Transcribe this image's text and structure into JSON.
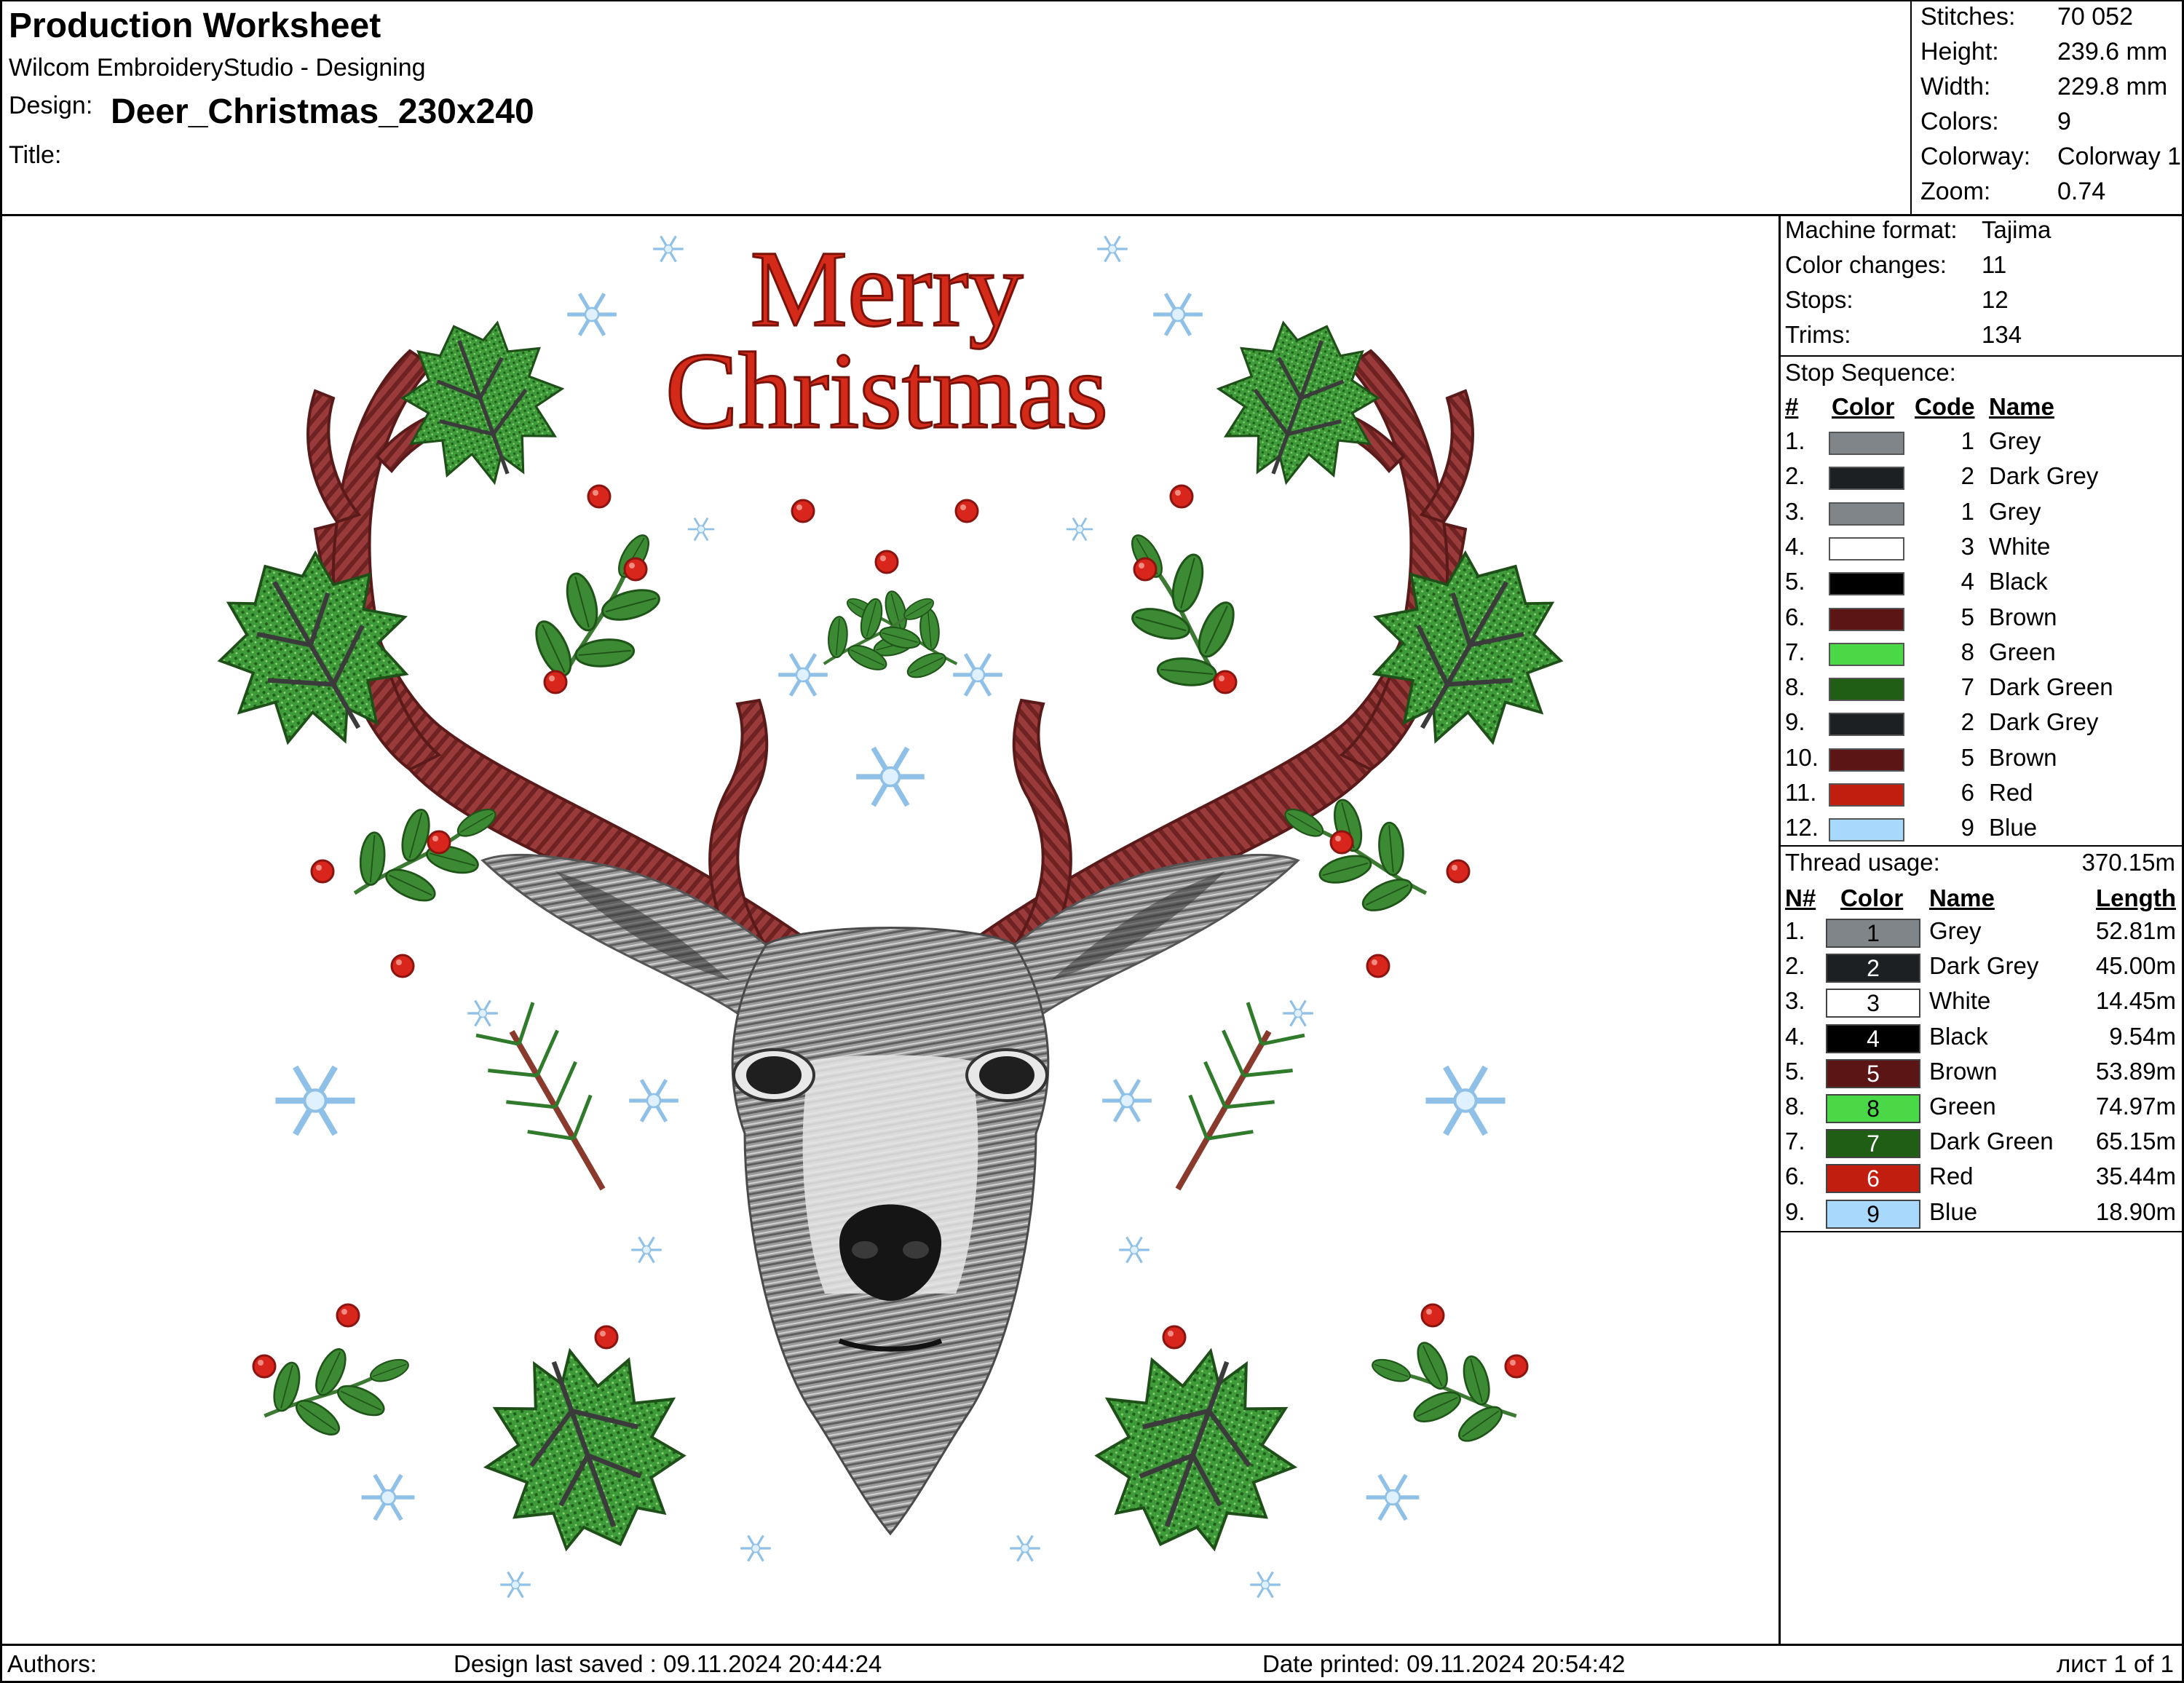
{
  "header": {
    "title": "Production Worksheet",
    "app": "Wilcom EmbroideryStudio - Designing",
    "design_label": "Design:",
    "design_name": "Deer_Christmas_230x240",
    "title_label": "Title:",
    "title_value": ""
  },
  "stats": [
    {
      "label": "Stitches:",
      "value": "70 052"
    },
    {
      "label": "Height:",
      "value": "239.6 mm"
    },
    {
      "label": "Width:",
      "value": "229.8 mm"
    },
    {
      "label": "Colors:",
      "value": "9"
    },
    {
      "label": "Colorway:",
      "value": "Colorway 1"
    },
    {
      "label": "Zoom:",
      "value": "0.74"
    }
  ],
  "machine": [
    {
      "label": "Machine format:",
      "value": "Tajima"
    },
    {
      "label": "Color changes:",
      "value": "11"
    },
    {
      "label": "Stops:",
      "value": "12"
    },
    {
      "label": "Trims:",
      "value": "134"
    }
  ],
  "stop_sequence": {
    "label": "Stop Sequence:",
    "headers": {
      "num": "#",
      "color": "Color",
      "code": "Code",
      "name": "Name"
    },
    "rows": [
      {
        "num": "1.",
        "code": "1",
        "name": "Grey",
        "color": "#7f8588"
      },
      {
        "num": "2.",
        "code": "2",
        "name": "Dark Grey",
        "color": "#1c2022"
      },
      {
        "num": "3.",
        "code": "1",
        "name": "Grey",
        "color": "#7f8588"
      },
      {
        "num": "4.",
        "code": "3",
        "name": "White",
        "color": "#ffffff"
      },
      {
        "num": "5.",
        "code": "4",
        "name": "Black",
        "color": "#000000"
      },
      {
        "num": "6.",
        "code": "5",
        "name": "Brown",
        "color": "#5c1515"
      },
      {
        "num": "7.",
        "code": "8",
        "name": "Green",
        "color": "#4bd846"
      },
      {
        "num": "8.",
        "code": "7",
        "name": "Dark Green",
        "color": "#205e15"
      },
      {
        "num": "9.",
        "code": "2",
        "name": "Dark Grey",
        "color": "#1c2022"
      },
      {
        "num": "10.",
        "code": "5",
        "name": "Brown",
        "color": "#5c1515"
      },
      {
        "num": "11.",
        "code": "6",
        "name": "Red",
        "color": "#c21e0f"
      },
      {
        "num": "12.",
        "code": "9",
        "name": "Blue",
        "color": "#a8d8fb"
      }
    ]
  },
  "thread_usage": {
    "label": "Thread usage:",
    "total": "370.15m",
    "headers": {
      "num": "N#",
      "color": "Color",
      "name": "Name",
      "length": "Length"
    },
    "rows": [
      {
        "num": "1.",
        "code": "1",
        "name": "Grey",
        "length": "52.81m",
        "color": "#7f8588",
        "text_color": "#000000"
      },
      {
        "num": "2.",
        "code": "2",
        "name": "Dark Grey",
        "length": "45.00m",
        "color": "#1c2022",
        "text_color": "#ffffff"
      },
      {
        "num": "3.",
        "code": "3",
        "name": "White",
        "length": "14.45m",
        "color": "#ffffff",
        "text_color": "#000000"
      },
      {
        "num": "4.",
        "code": "4",
        "name": "Black",
        "length": "9.54m",
        "color": "#000000",
        "text_color": "#ffffff"
      },
      {
        "num": "5.",
        "code": "5",
        "name": "Brown",
        "length": "53.89m",
        "color": "#5c1515",
        "text_color": "#ffffff"
      },
      {
        "num": "8.",
        "code": "8",
        "name": "Green",
        "length": "74.97m",
        "color": "#4bd846",
        "text_color": "#000000"
      },
      {
        "num": "7.",
        "code": "7",
        "name": "Dark Green",
        "length": "65.15m",
        "color": "#205e15",
        "text_color": "#ffffff"
      },
      {
        "num": "6.",
        "code": "6",
        "name": "Red",
        "length": "35.44m",
        "color": "#c21e0f",
        "text_color": "#ffffff"
      },
      {
        "num": "9.",
        "code": "9",
        "name": "Blue",
        "length": "18.90m",
        "color": "#a8d8fb",
        "text_color": "#000000"
      }
    ]
  },
  "design_text": {
    "line1": "Merry",
    "line2": "Christmas"
  },
  "footer": {
    "authors": "Authors:",
    "saved": "Design last saved : 09.11.2024 20:44:24",
    "printed": "Date printed: 09.11.2024 20:54:42",
    "page": "лист 1 of 1"
  }
}
